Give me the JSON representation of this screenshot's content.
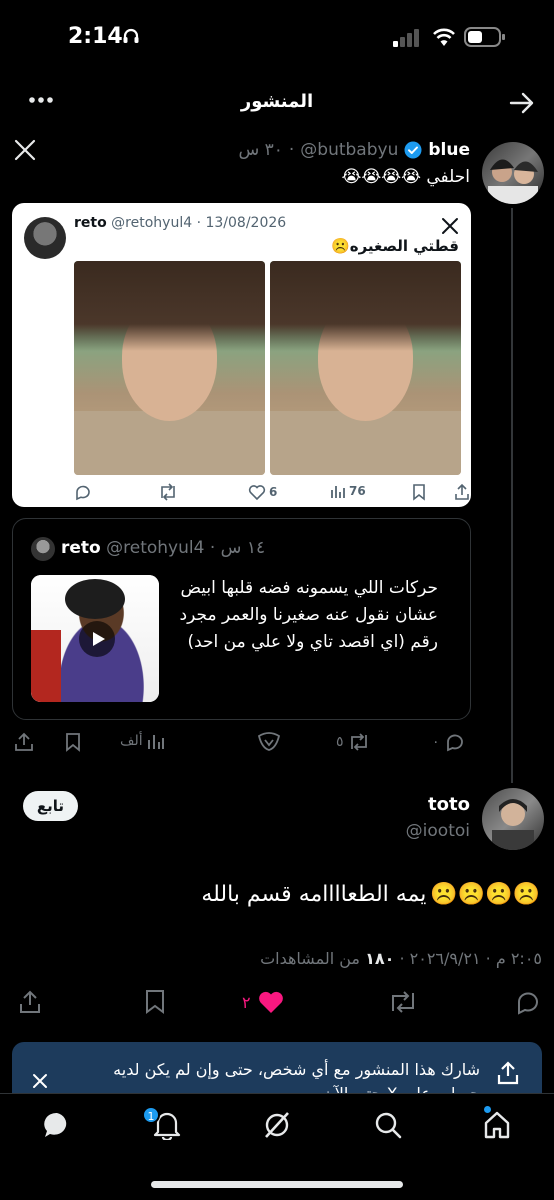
{
  "status_bar": {
    "time": "2:14"
  },
  "header": {
    "title": "المنشور"
  },
  "parent_tweet": {
    "name": "blue",
    "handle": "@butbabyu",
    "time": "٣٠ س",
    "text": "احلفي 😭😭😭😭"
  },
  "embedded_card": {
    "name": "reto",
    "handle": "@retohyul4",
    "date": "13/08/2026",
    "text": "قطتي الصغيره☹️",
    "likes": "6",
    "views": "76"
  },
  "quoted_tweet": {
    "name": "reto",
    "handle": "@retohyul4",
    "time": "١٤ س",
    "text": "حركات اللي يسمونه فضه قلبها ابيض عشان نقول عنه صغيرنا والعمر مجرد رقم (اي اقصد تاي ولا علي من احد)"
  },
  "parent_actions": {
    "replies": "٠",
    "reposts": "٥",
    "views": "ألف"
  },
  "main_tweet": {
    "name": "toto",
    "handle": "@iootoi",
    "follow_label": "تابع",
    "text": "يمه الطعاااامه قسم بالله",
    "emojis": "☹️☹️☹️☹️",
    "timestamp": "٢:٠٥ م · ٢٠٢٦/٩/٢١",
    "views_count": "١٨٠",
    "views_label": "من المشاهدات",
    "likes": "٢"
  },
  "share_toast": {
    "text": "شارك هذا المنشور مع أي شخص، حتى وإن لم يكن لديه حساب على X حتى الآن"
  },
  "nav": {
    "notification_count": "1"
  },
  "colors": {
    "background": "#000000",
    "accent": "#1d9bf0",
    "like": "#f91880",
    "toast": "#1d3b5c"
  }
}
